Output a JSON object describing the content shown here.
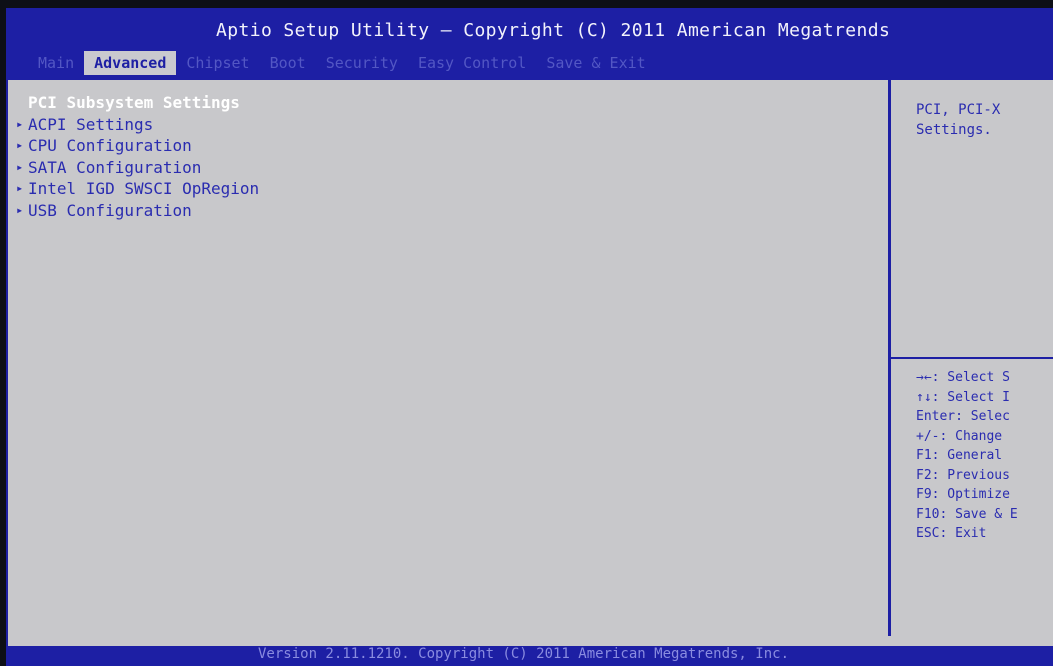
{
  "header": {
    "title": "Aptio Setup Utility – Copyright (C) 2011 American Megatrends"
  },
  "tabs": [
    {
      "label": "Main",
      "active": false
    },
    {
      "label": "Advanced",
      "active": true
    },
    {
      "label": "Chipset",
      "active": false
    },
    {
      "label": "Boot",
      "active": false
    },
    {
      "label": "Security",
      "active": false
    },
    {
      "label": "Easy Control",
      "active": false
    },
    {
      "label": "Save & Exit",
      "active": false
    }
  ],
  "menu": {
    "items": [
      {
        "label": "PCI Subsystem Settings",
        "selected": true
      },
      {
        "label": "ACPI Settings",
        "selected": false
      },
      {
        "label": "CPU Configuration",
        "selected": false
      },
      {
        "label": "SATA Configuration",
        "selected": false
      },
      {
        "label": "Intel IGD SWSCI OpRegion",
        "selected": false
      },
      {
        "label": "USB Configuration",
        "selected": false
      }
    ]
  },
  "help": {
    "line1": "PCI, PCI-X",
    "line2": "Settings."
  },
  "keys": [
    "→←: Select S",
    "↑↓: Select I",
    "Enter: Selec",
    "+/-: Change",
    "F1: General",
    "F2: Previous",
    "F9: Optimize",
    "F10: Save & E",
    "ESC: Exit"
  ],
  "footer": {
    "text": "Version 2.11.1210. Copyright (C) 2011 American Megatrends, Inc."
  },
  "colors": {
    "bios_blue": "#1d1fa4",
    "panel_gray": "#c8c8cb",
    "selected_text": "#ffffff"
  }
}
